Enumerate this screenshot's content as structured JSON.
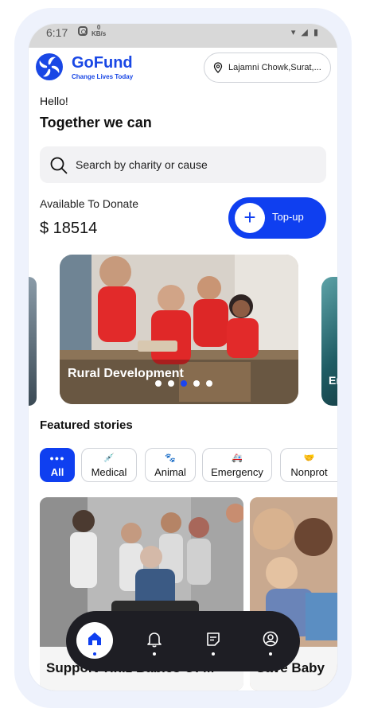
{
  "status_bar": {
    "time": "6:17",
    "data_rate": "0",
    "data_unit": "KB/s"
  },
  "header": {
    "brand": "GoFund",
    "tagline": "Change Lives Today",
    "location": "Lajamni Chowk,Surat,..."
  },
  "greeting": {
    "hello": "Hello!",
    "subtitle": "Together we can"
  },
  "search": {
    "placeholder": "Search by charity or cause"
  },
  "balance": {
    "label": "Available To Donate",
    "amount": "$ 18514"
  },
  "topup": {
    "label": "Top-up",
    "plus": "+"
  },
  "carousel": {
    "active_title": "Rural Development",
    "next_title_partial": "Er",
    "dot_count": 5,
    "active_dot": 3
  },
  "featured": {
    "title": "Featured stories"
  },
  "categories": [
    {
      "label": "All",
      "icon": "all-dots-icon",
      "active": true
    },
    {
      "label": "Medical",
      "icon": "syringe-icon",
      "active": false
    },
    {
      "label": "Animal",
      "icon": "paw-icon",
      "active": false
    },
    {
      "label": "Emergency",
      "icon": "ambulance-icon",
      "active": false
    },
    {
      "label": "Nonprot",
      "icon": "handshake-icon",
      "active": false
    }
  ],
  "stories": [
    {
      "title": "Support Tiniz Babies Of M"
    },
    {
      "title": "Save Baby"
    }
  ],
  "bottom_nav": [
    {
      "name": "home",
      "icon": "home-icon",
      "active": true
    },
    {
      "name": "notifications",
      "icon": "bell-icon",
      "active": false
    },
    {
      "name": "notes",
      "icon": "note-icon",
      "active": false
    },
    {
      "name": "profile",
      "icon": "profile-icon",
      "active": false
    }
  ],
  "colors": {
    "brand": "#1947e5",
    "accent": "#0f3ff0",
    "nav_bg": "#1e1e24"
  }
}
